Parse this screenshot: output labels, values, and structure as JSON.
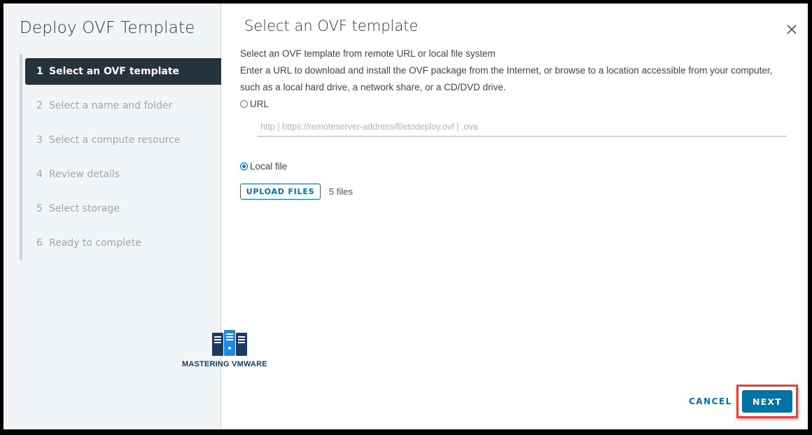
{
  "wizard": {
    "title": "Deploy OVF Template",
    "steps": [
      {
        "num": "1",
        "label": "Select an OVF template",
        "active": true
      },
      {
        "num": "2",
        "label": "Select a name and folder",
        "active": false
      },
      {
        "num": "3",
        "label": "Select a compute resource",
        "active": false
      },
      {
        "num": "4",
        "label": "Review details",
        "active": false
      },
      {
        "num": "5",
        "label": "Select storage",
        "active": false
      },
      {
        "num": "6",
        "label": "Ready to complete",
        "active": false
      }
    ]
  },
  "logo": {
    "text": "MASTERING VMWARE",
    "icon": "server-rack-icon"
  },
  "main": {
    "title": "Select an OVF template",
    "close_icon": "close-icon",
    "description_line1": "Select an OVF template from remote URL or local file system",
    "description_line2": "Enter a URL to download and install the OVF package from the Internet, or browse to a location accessible from your computer, such as a local hard drive, a network share, or a CD/DVD drive.",
    "source_options": [
      {
        "label": "URL",
        "selected": false
      },
      {
        "label": "Local file",
        "selected": true
      }
    ],
    "url_input": {
      "value": "",
      "placeholder": "http | https://remoteserver-address/filetodeploy.ovf | .ova"
    },
    "upload_button": "UPLOAD FILES",
    "file_count": "5 files"
  },
  "footer": {
    "cancel": "CANCEL",
    "next": "NEXT",
    "highlight_color": "#e8423f",
    "primary_color": "#0072a3"
  }
}
